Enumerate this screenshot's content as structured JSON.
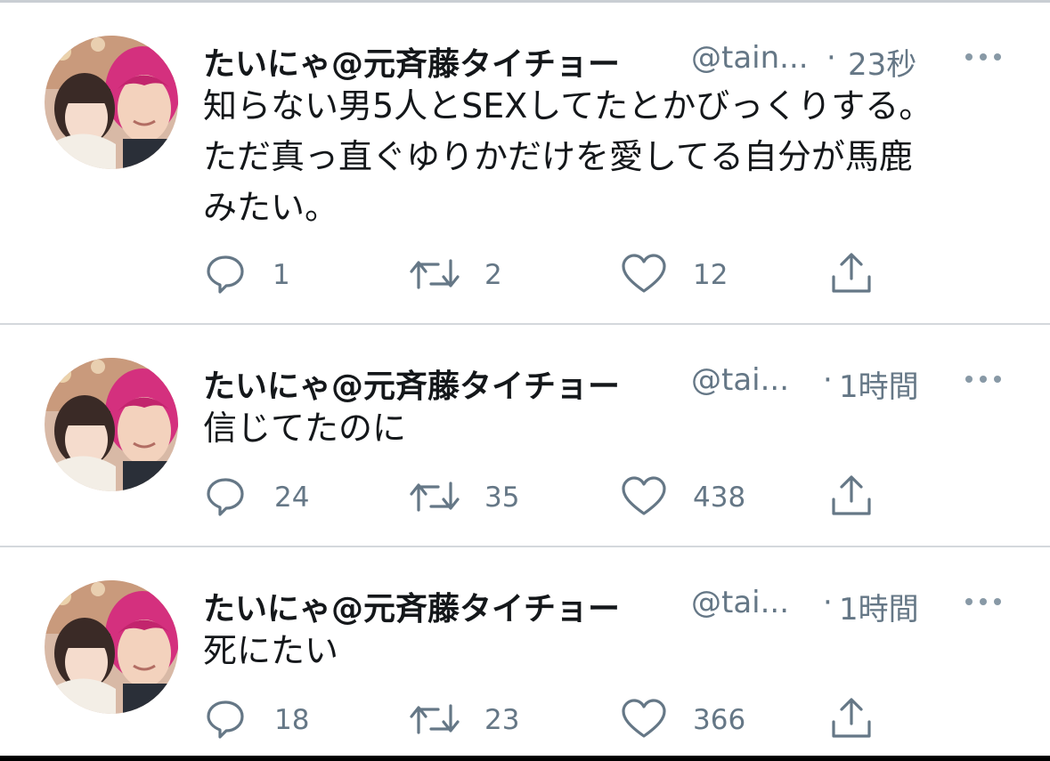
{
  "tweets": [
    {
      "display_name": "たいにゃ@元斉藤タイチョー",
      "handle": "@tain...",
      "separator": "·",
      "time": "23秒",
      "text": "知らない男5人とSEXしてたとかびっくりする。\nただ真っ直ぐゆりかだけを愛してる自分が馬鹿\nみたい。",
      "reply_count": "1",
      "retweet_count": "2",
      "like_count": "12"
    },
    {
      "display_name": "たいにゃ@元斉藤タイチョー",
      "handle": "@tai...",
      "separator": "·",
      "time": "1時間",
      "text": "信じてたのに",
      "reply_count": "24",
      "retweet_count": "35",
      "like_count": "438"
    },
    {
      "display_name": "たいにゃ@元斉藤タイチョー",
      "handle": "@tai...",
      "separator": "·",
      "time": "1時間",
      "text": "死にたい",
      "reply_count": "18",
      "retweet_count": "23",
      "like_count": "366"
    }
  ],
  "icons": {
    "reply": "reply-icon",
    "retweet": "retweet-icon",
    "like": "like-icon",
    "share": "share-icon",
    "more": "more-icon"
  },
  "colors": {
    "text": "#14171a",
    "secondary": "#657786",
    "divider": "#d4d8dc"
  }
}
